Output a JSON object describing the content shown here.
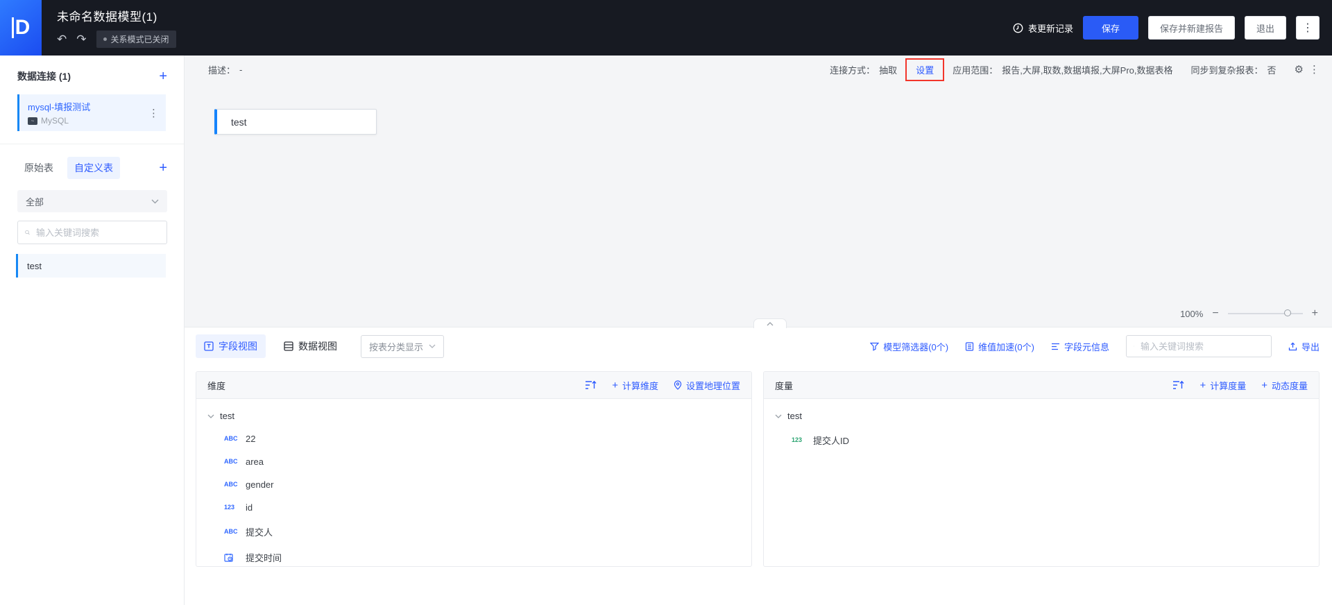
{
  "header": {
    "title": "未命名数据模型(1)",
    "mode_badge": "关系模式已关闭",
    "update_log": "表更新记录",
    "save": "保存",
    "save_new_report": "保存并新建报告",
    "exit": "退出",
    "logo_letter": "D"
  },
  "model_toolbar": {
    "description_label": "描述：",
    "description_value": "-",
    "connect_label": "连接方式：",
    "connect_value": "抽取",
    "settings_link": "设置",
    "scope_label": "应用范围：",
    "scope_value": "报告,大屏,取数,数据填报,大屏Pro,数据表格",
    "sync_label": "同步到复杂报表：",
    "sync_value": "否"
  },
  "sidebar": {
    "connections_title": "数据连接 (1)",
    "connection": {
      "name": "mysql-填报测试",
      "type": "MySQL"
    },
    "tabs": [
      {
        "label": "原始表"
      },
      {
        "label": "自定义表"
      }
    ],
    "filter_value": "全部",
    "search_placeholder": "输入关键词搜索",
    "table_item": "test"
  },
  "canvas": {
    "node_label": "test",
    "zoom_percent": "100%"
  },
  "bottom": {
    "view_tabs": [
      {
        "label": "字段视图"
      },
      {
        "label": "数据视图"
      }
    ],
    "group_select": "按表分类显示",
    "links": {
      "filter": "模型筛选器(0个)",
      "accelerate": "维值加速(0个)",
      "meta": "字段元信息",
      "export": "导出"
    },
    "search_placeholder": "输入关键词搜索",
    "dimensions": {
      "title": "维度",
      "actions": [
        "计算维度",
        "设置地理位置"
      ],
      "group": "test",
      "fields": [
        {
          "icon": "ABC",
          "name": "22"
        },
        {
          "icon": "ABC",
          "name": "area"
        },
        {
          "icon": "ABC",
          "name": "gender"
        },
        {
          "icon": "123",
          "name": "id"
        },
        {
          "icon": "ABC",
          "name": "提交人"
        },
        {
          "icon": "datetime",
          "name": "提交时间"
        }
      ]
    },
    "measures": {
      "title": "度量",
      "actions": [
        "计算度量",
        "动态度量"
      ],
      "group": "test",
      "fields": [
        {
          "icon": "123",
          "name": "提交人ID"
        }
      ]
    }
  },
  "icons": {
    "plus": "+",
    "minus": "−",
    "kebab": "⋮",
    "gear": "⚙",
    "undo": "↶",
    "redo": "↷",
    "mysql_chip": "~"
  },
  "colors": {
    "accent_blue": "#2e5bff",
    "selection_bar_blue": "#1788f5",
    "measure_green": "#2ba471",
    "highlight_red": "#f2352b",
    "header_dark": "#171a22",
    "canvas_gray": "#f4f5f7"
  }
}
